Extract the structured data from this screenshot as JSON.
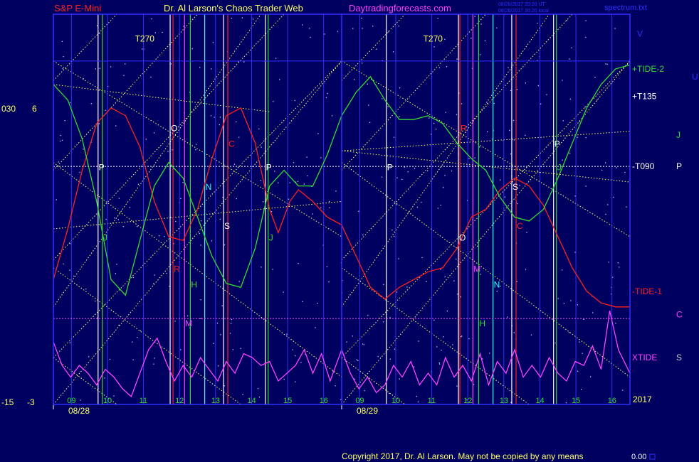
{
  "header": {
    "instrument": "S&P E-Mini",
    "author": "Dr. Al Larson's Chaos Trader Web",
    "site": "Daytradingforecasts.com",
    "stamp1": "08/28/2017 20:20 UT",
    "stamp2": "08/28/2017 16:20 local",
    "file": "spectrum.txt"
  },
  "footer": {
    "copyright": "Copyright 2017, Dr. Al Larson. May not be copied by any means",
    "counter": "0.00"
  },
  "colors": {
    "background": "#000060",
    "plot_border": "#3030ff",
    "tide1": "#ff2020",
    "tide2": "#30dd30",
    "xtide": "#ff40ff",
    "grid_lines": "#ffff66"
  },
  "chart_data": {
    "type": "line",
    "days": [
      {
        "date": "08/28",
        "hours": [
          "09",
          "10",
          "11",
          "12",
          "13",
          "14",
          "15",
          "16"
        ]
      },
      {
        "date": "08/29",
        "hours": [
          "09",
          "10",
          "11",
          "12",
          "13",
          "14",
          "15",
          "16"
        ]
      }
    ],
    "x_range": [
      0,
      2
    ],
    "left_axis": {
      "top_inner": "6",
      "bottom_inner": "-3",
      "top_outer": "030",
      "bottom_outer": "-15"
    },
    "year_label": "2017",
    "right_labels": [
      {
        "text": "+TIDE-2",
        "color": "#30dd30",
        "value": 0.86
      },
      {
        "text": "+T135",
        "color": "#ffffff",
        "value": 0.79
      },
      {
        "text": "-T090",
        "color": "#ffffff",
        "value": 0.61
      },
      {
        "text": "-TIDE-1",
        "color": "#ff2020",
        "value": 0.29
      },
      {
        "text": "XTIDE",
        "color": "#ff40ff",
        "value": 0.12
      }
    ],
    "edge_letters": [
      {
        "text": "V",
        "color": "#3030ff",
        "value": 0.95
      },
      {
        "text": "U",
        "color": "#3030ff",
        "value": 0.84
      },
      {
        "text": "J",
        "color": "#30dd30",
        "value": 0.69
      },
      {
        "text": "P",
        "color": "#ffffff",
        "value": 0.61
      },
      {
        "text": "C",
        "color": "#ff40ff",
        "value": 0.23
      },
      {
        "text": "S",
        "color": "#cccccc",
        "value": 0.12
      }
    ],
    "vertical_events": [
      {
        "label": "P",
        "color": "#ffffff",
        "x": 0.155
      },
      {
        "label": "J",
        "color": "#30dd30",
        "x": 0.17
      },
      {
        "label": "O",
        "color": "#ffffff",
        "x": 0.405
      },
      {
        "label": "R",
        "color": "#ff2020",
        "x": 0.415
      },
      {
        "label": "M",
        "color": "#ff40ff",
        "x": 0.455
      },
      {
        "label": "H",
        "color": "#30dd30",
        "x": 0.475
      },
      {
        "label": "N",
        "color": "#30ffff",
        "x": 0.525
      },
      {
        "label": "S",
        "color": "#ffffff",
        "x": 0.59
      },
      {
        "label": "C",
        "color": "#ff2020",
        "x": 0.605
      },
      {
        "label": "P",
        "color": "#ffffff",
        "x": 0.735
      },
      {
        "label": "J",
        "color": "#30dd30",
        "x": 0.745
      },
      {
        "label": "P",
        "color": "#ffffff",
        "x": 1.155
      },
      {
        "label": "O",
        "color": "#ffffff",
        "x": 1.405
      },
      {
        "label": "R",
        "color": "#ff2020",
        "x": 1.41
      },
      {
        "label": "M",
        "color": "#ff40ff",
        "x": 1.455
      },
      {
        "label": "H",
        "color": "#30dd30",
        "x": 1.475
      },
      {
        "label": "N",
        "color": "#30ffff",
        "x": 1.525
      },
      {
        "label": "S",
        "color": "#ffffff",
        "x": 1.59
      },
      {
        "label": "C",
        "color": "#ff2020",
        "x": 1.605
      },
      {
        "label": "P",
        "color": "#ffffff",
        "x": 1.735
      },
      {
        "label": "J",
        "color": "#30dd30",
        "x": 1.745
      }
    ],
    "annotations": [
      {
        "text": "T270",
        "color": "#ffff66",
        "x": 0.32,
        "y": 0.93
      },
      {
        "text": "T270",
        "color": "#ffff66",
        "x": 1.32,
        "y": 0.93
      }
    ],
    "series": [
      {
        "name": "-TIDE-1",
        "color": "#ff2020",
        "x": [
          0.0,
          0.05,
          0.1,
          0.15,
          0.2,
          0.25,
          0.3,
          0.35,
          0.4,
          0.45,
          0.5,
          0.55,
          0.6,
          0.65,
          0.7,
          0.75,
          0.78,
          0.82,
          0.85,
          0.9,
          0.95,
          1.0,
          1.05,
          1.1,
          1.15,
          1.2,
          1.25,
          1.3,
          1.35,
          1.4,
          1.45,
          1.5,
          1.55,
          1.6,
          1.65,
          1.7,
          1.75,
          1.8,
          1.85,
          1.9,
          1.95,
          2.0
        ],
        "y": [
          0.32,
          0.45,
          0.6,
          0.72,
          0.76,
          0.74,
          0.66,
          0.52,
          0.43,
          0.42,
          0.5,
          0.63,
          0.74,
          0.76,
          0.67,
          0.5,
          0.44,
          0.52,
          0.55,
          0.52,
          0.48,
          0.46,
          0.38,
          0.3,
          0.27,
          0.3,
          0.32,
          0.34,
          0.35,
          0.4,
          0.48,
          0.5,
          0.55,
          0.58,
          0.56,
          0.51,
          0.43,
          0.35,
          0.29,
          0.26,
          0.25,
          0.25
        ]
      },
      {
        "name": "+TIDE-2",
        "color": "#30dd30",
        "x": [
          0.0,
          0.05,
          0.1,
          0.15,
          0.2,
          0.25,
          0.3,
          0.35,
          0.4,
          0.45,
          0.5,
          0.55,
          0.6,
          0.65,
          0.7,
          0.75,
          0.8,
          0.85,
          0.9,
          0.95,
          1.0,
          1.05,
          1.1,
          1.15,
          1.2,
          1.25,
          1.3,
          1.35,
          1.4,
          1.45,
          1.5,
          1.55,
          1.6,
          1.65,
          1.7,
          1.75,
          1.8,
          1.85,
          1.9,
          1.95,
          2.0
        ],
        "y": [
          0.82,
          0.78,
          0.68,
          0.52,
          0.32,
          0.28,
          0.42,
          0.56,
          0.62,
          0.58,
          0.48,
          0.38,
          0.31,
          0.3,
          0.4,
          0.56,
          0.6,
          0.56,
          0.56,
          0.64,
          0.74,
          0.8,
          0.84,
          0.78,
          0.73,
          0.73,
          0.74,
          0.72,
          0.67,
          0.63,
          0.6,
          0.53,
          0.48,
          0.47,
          0.5,
          0.58,
          0.67,
          0.76,
          0.82,
          0.86,
          0.87
        ]
      },
      {
        "name": "XTIDE",
        "color": "#ff40ff",
        "x": [
          0.0,
          0.03,
          0.06,
          0.09,
          0.12,
          0.15,
          0.18,
          0.21,
          0.24,
          0.27,
          0.3,
          0.33,
          0.36,
          0.39,
          0.42,
          0.45,
          0.48,
          0.51,
          0.54,
          0.57,
          0.6,
          0.63,
          0.66,
          0.69,
          0.72,
          0.75,
          0.78,
          0.81,
          0.84,
          0.87,
          0.9,
          0.93,
          0.96,
          1.0,
          1.03,
          1.06,
          1.09,
          1.12,
          1.15,
          1.18,
          1.21,
          1.24,
          1.27,
          1.3,
          1.33,
          1.36,
          1.39,
          1.42,
          1.45,
          1.48,
          1.51,
          1.54,
          1.57,
          1.6,
          1.63,
          1.66,
          1.69,
          1.72,
          1.75,
          1.78,
          1.81,
          1.84,
          1.87,
          1.9,
          1.93,
          1.96,
          2.0
        ],
        "y": [
          0.16,
          0.1,
          0.07,
          0.1,
          0.08,
          0.05,
          0.09,
          0.07,
          0.04,
          0.02,
          0.08,
          0.14,
          0.17,
          0.11,
          0.06,
          0.1,
          0.07,
          0.12,
          0.09,
          0.06,
          0.11,
          0.08,
          0.13,
          0.12,
          0.1,
          0.11,
          0.06,
          0.08,
          0.1,
          0.14,
          0.08,
          0.13,
          0.06,
          0.14,
          0.08,
          0.04,
          0.07,
          0.03,
          0.05,
          0.1,
          0.07,
          0.11,
          0.05,
          0.08,
          0.05,
          0.12,
          0.07,
          0.1,
          0.06,
          0.13,
          0.05,
          0.11,
          0.08,
          0.14,
          0.07,
          0.1,
          0.07,
          0.12,
          0.08,
          0.06,
          0.11,
          0.1,
          0.15,
          0.09,
          0.24,
          0.14,
          0.08
        ]
      }
    ],
    "x_level_lines": [
      {
        "color": "#ffffff",
        "style": "dotted",
        "y": 0.61
      },
      {
        "color": "#ff40ff",
        "style": "dotted",
        "y": 0.22
      },
      {
        "color": "#3030ff",
        "style": "solid",
        "y": 0.88
      }
    ]
  }
}
